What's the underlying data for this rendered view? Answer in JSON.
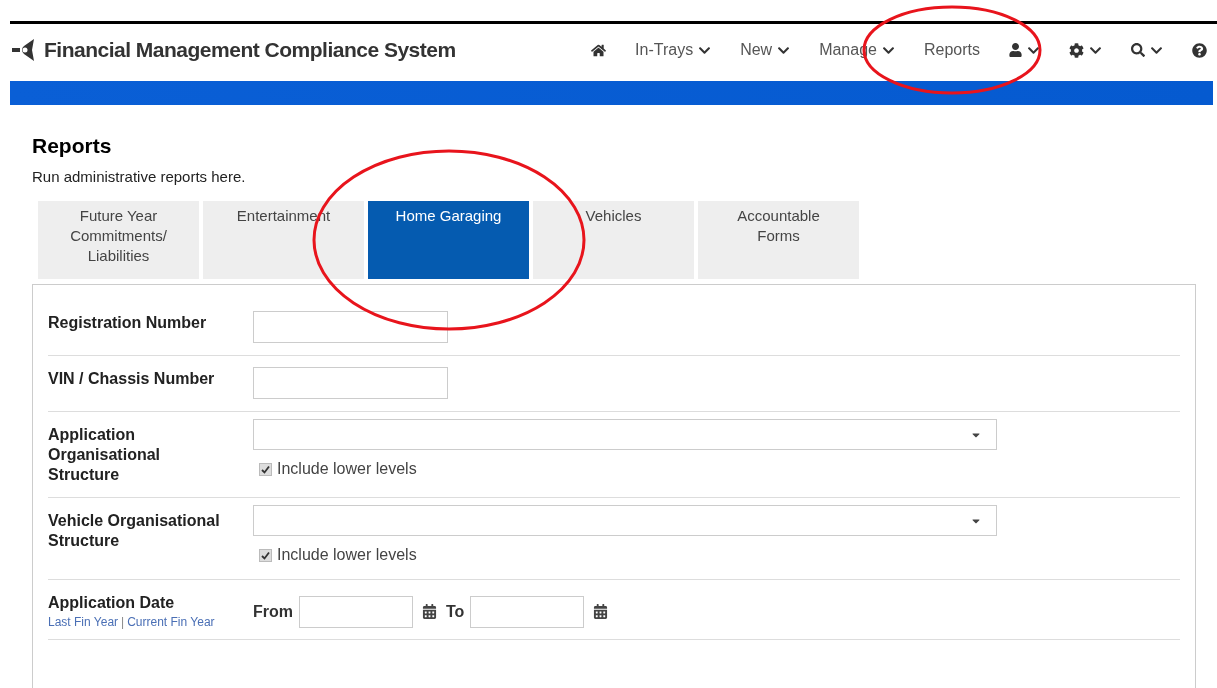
{
  "header": {
    "title": "Financial Management Compliance System",
    "nav": [
      {
        "kind": "home",
        "dropdown": false,
        "circled": false
      },
      {
        "kind": "text",
        "label": "In-Trays",
        "dropdown": true,
        "circled": false
      },
      {
        "kind": "text",
        "label": "New",
        "dropdown": true,
        "circled": false
      },
      {
        "kind": "text",
        "label": "Manage",
        "dropdown": true,
        "circled": false
      },
      {
        "kind": "text",
        "label": "Reports",
        "dropdown": false,
        "circled": true
      },
      {
        "kind": "user",
        "dropdown": true,
        "circled": false
      },
      {
        "kind": "settings",
        "dropdown": true,
        "circled": false
      },
      {
        "kind": "search",
        "dropdown": true,
        "circled": false
      },
      {
        "kind": "help",
        "dropdown": false,
        "circled": false
      }
    ]
  },
  "page": {
    "title": "Reports",
    "subtitle": "Run administrative reports here."
  },
  "tabs": [
    {
      "label": "Future Year Commitments/ Liabilities",
      "selected": false,
      "circled": false
    },
    {
      "label": "Entertainment",
      "selected": false,
      "circled": false
    },
    {
      "label": "Home Garaging",
      "selected": true,
      "circled": true
    },
    {
      "label": "Vehicles",
      "selected": false,
      "circled": false
    },
    {
      "label": "Accountable Forms",
      "selected": false,
      "circled": false
    }
  ],
  "form": [
    {
      "kind": "text",
      "label": "Registration Number"
    },
    {
      "kind": "text",
      "label": "VIN / Chassis Number"
    },
    {
      "kind": "select",
      "label": "Application Organisational Structure",
      "checkbox": {
        "label": "Include lower levels",
        "checked": true
      }
    },
    {
      "kind": "select",
      "label": "Vehicle Organisational Structure",
      "checkbox": {
        "label": "Include lower levels",
        "checked": true
      }
    },
    {
      "kind": "date_range",
      "label": "Application Date",
      "links": [
        "Last Fin Year",
        "Current Fin Year"
      ],
      "separator": "|",
      "from": "From",
      "to": "To"
    }
  ]
}
